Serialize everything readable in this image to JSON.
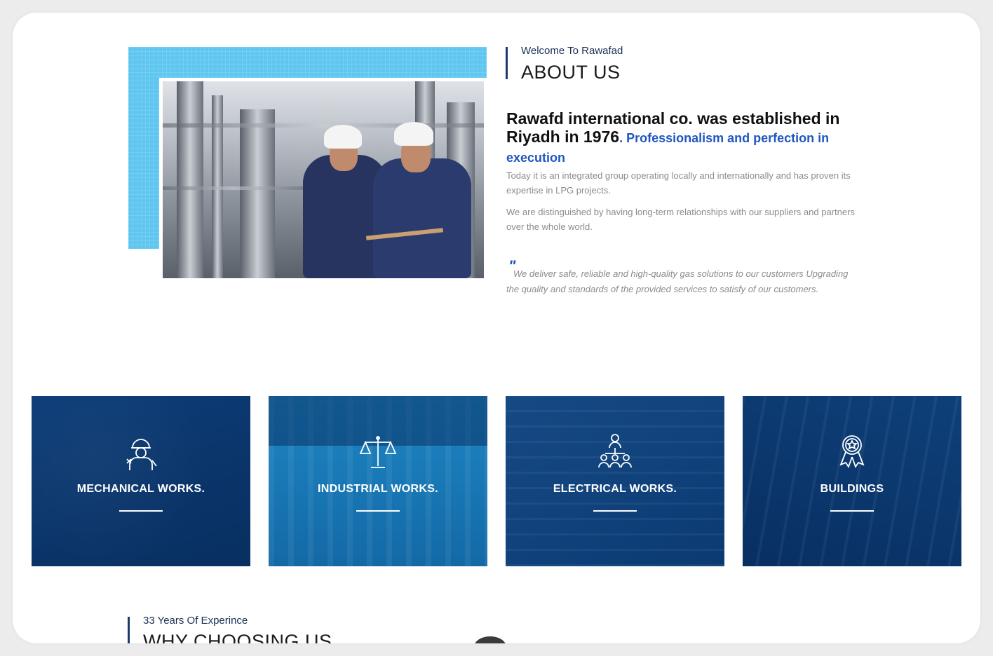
{
  "about": {
    "kicker": "Welcome To Rawafad",
    "title": "ABOUT US",
    "headline_main": "Rawafd international co. was established in Riyadh in 1976",
    "headline_dot": ".",
    "headline_accent": " Professionalism and perfection in execution",
    "paragraph_1": "Today it is an integrated group operating locally and internationally and has proven its expertise in LPG projects.",
    "paragraph_2": "We are distinguished by having long-term relationships with our suppliers and partners over the whole world.",
    "quote_mark": "\"",
    "quote": "We deliver safe, reliable and high-quality gas solutions to our customers Upgrading the quality and standards of the provided services to satisfy of our customers."
  },
  "services": [
    {
      "label": "MECHANICAL WORKS.",
      "icon": "worker-icon"
    },
    {
      "label": "INDUSTRIAL WORKS.",
      "icon": "scales-icon"
    },
    {
      "label": "ELECTRICAL WORKS.",
      "icon": "team-icon"
    },
    {
      "label": "BUILDINGS",
      "icon": "award-icon"
    }
  ],
  "why": {
    "kicker": "33 Years Of Experince",
    "title": "WHY CHOOSING US"
  },
  "colors": {
    "accent_blue": "#1f56c2",
    "navy": "#0b3a72",
    "light_blue": "#5fc6f0"
  }
}
